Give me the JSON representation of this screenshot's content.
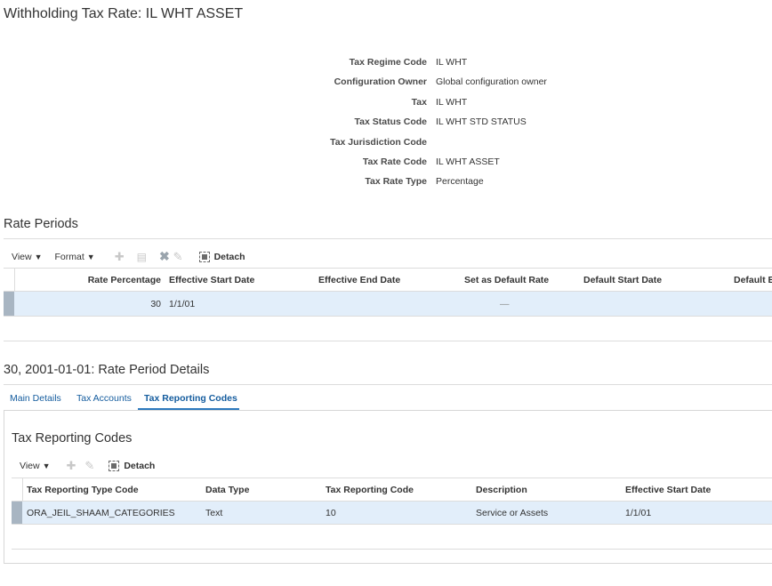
{
  "page": {
    "title": "Withholding Tax Rate: IL WHT ASSET"
  },
  "header_form": [
    {
      "label": "Tax Regime Code",
      "value": "IL WHT"
    },
    {
      "label": "Configuration Owner",
      "value": "Global configuration owner"
    },
    {
      "label": "Tax",
      "value": "IL WHT"
    },
    {
      "label": "Tax Status Code",
      "value": "IL WHT STD STATUS"
    },
    {
      "label": "Tax Jurisdiction Code",
      "value": ""
    },
    {
      "label": "Tax Rate Code",
      "value": "IL WHT ASSET"
    },
    {
      "label": "Tax Rate Type",
      "value": "Percentage"
    }
  ],
  "rate_periods": {
    "title": "Rate Periods",
    "toolbar": {
      "view_label": "View",
      "format_label": "Format",
      "detach_label": "Detach",
      "icons": [
        "add-icon",
        "save-icon",
        "delete-icon",
        "edit-icon",
        "detach-icon"
      ]
    },
    "columns": [
      "Rate Percentage",
      "Effective Start Date",
      "Effective End Date",
      "Set as Default Rate",
      "Default Start Date",
      "Default E"
    ],
    "rows": [
      {
        "rate_percentage": "30",
        "effective_start_date": "1/1/01",
        "effective_end_date": "",
        "set_as_default_rate": "—",
        "default_start_date": "",
        "default_end_date": ""
      }
    ]
  },
  "rate_period_details": {
    "title": "30, 2001-01-01: Rate Period Details",
    "tabs": [
      {
        "label": "Main Details",
        "active": false
      },
      {
        "label": "Tax Accounts",
        "active": false
      },
      {
        "label": "Tax Reporting Codes",
        "active": true
      }
    ],
    "tax_reporting_codes": {
      "title": "Tax Reporting Codes",
      "toolbar": {
        "view_label": "View",
        "detach_label": "Detach",
        "icons": [
          "add-icon",
          "edit-icon",
          "detach-icon"
        ]
      },
      "columns": [
        "Tax Reporting Type Code",
        "Data Type",
        "Tax Reporting Code",
        "Description",
        "Effective Start Date"
      ],
      "rows": [
        {
          "type_code": "ORA_JEIL_SHAAM_CATEGORIES",
          "data_type": "Text",
          "reporting_code": "10",
          "description": "Service or Assets",
          "effective_start_date": "1/1/01"
        }
      ]
    }
  },
  "colors": {
    "link": "#145c9e",
    "selected_row": "#e2eefa",
    "row_marker": "#a8b5c2",
    "divider": "#dcdcdc"
  }
}
